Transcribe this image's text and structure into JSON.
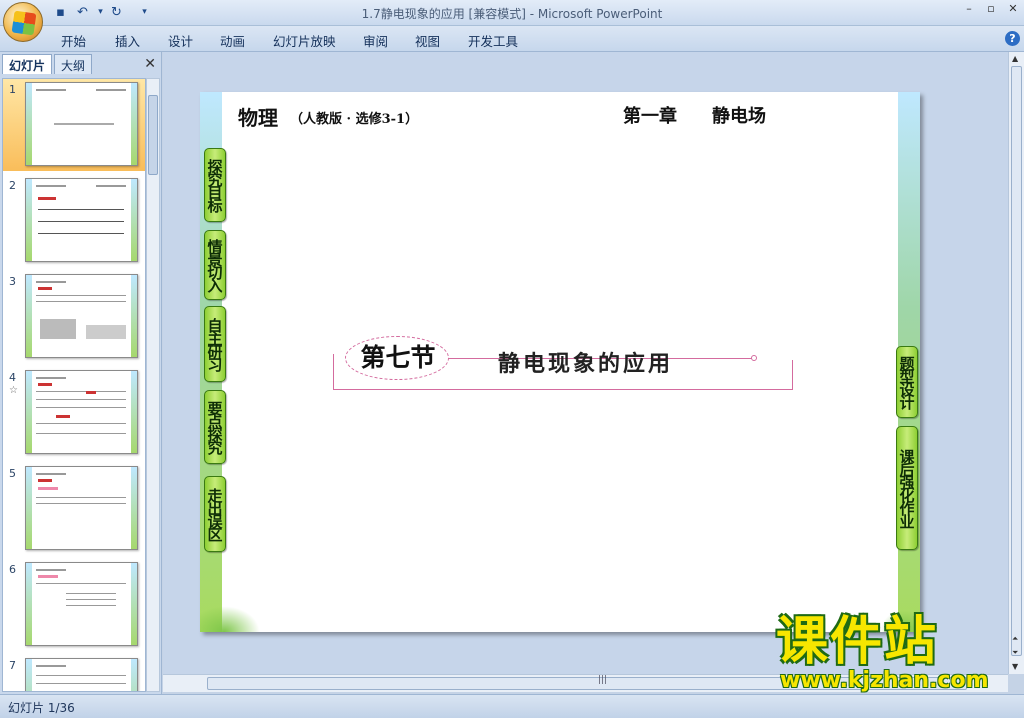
{
  "window": {
    "title": "1.7静电现象的应用 [兼容模式] - Microsoft PowerPoint",
    "controls": [
      "–",
      "▫",
      "✕"
    ]
  },
  "quick_access": {
    "save_icon": "save-icon",
    "undo_icon": "undo-icon",
    "redo_icon": "redo-icon",
    "customize_icon": "customize-icon"
  },
  "ribbon": {
    "tabs": [
      "开始",
      "插入",
      "设计",
      "动画",
      "幻灯片放映",
      "审阅",
      "视图",
      "开发工具"
    ],
    "help": "?"
  },
  "left_pane": {
    "tabs": [
      "幻灯片",
      "大纲"
    ],
    "close": "✕",
    "thumbnails": [
      {
        "num": "1",
        "star": ""
      },
      {
        "num": "2",
        "star": ""
      },
      {
        "num": "3",
        "star": ""
      },
      {
        "num": "4",
        "star": "☆"
      },
      {
        "num": "5",
        "star": ""
      },
      {
        "num": "6",
        "star": ""
      },
      {
        "num": "7",
        "star": ""
      }
    ]
  },
  "slide": {
    "subject": "物理",
    "edition": "（人教版 · 选修3-1）",
    "chapter": "第一章",
    "topic": "静电场",
    "left_nav": [
      "探究目标",
      "情景切入",
      "自主研习",
      "要点探究",
      "走出误区"
    ],
    "right_nav": [
      "题型设计",
      "课后强化作业"
    ],
    "section_number": "第七节",
    "section_title": "静电现象的应用"
  },
  "status": {
    "slide_counter": "幻灯片 1/36"
  },
  "watermark": {
    "title": "课件站",
    "url": "www.kjzhan.com"
  },
  "colors": {
    "nav_green": "#8ecf33",
    "section_pink": "#d46b9e",
    "selected_thumb": "#f9bd5a"
  }
}
